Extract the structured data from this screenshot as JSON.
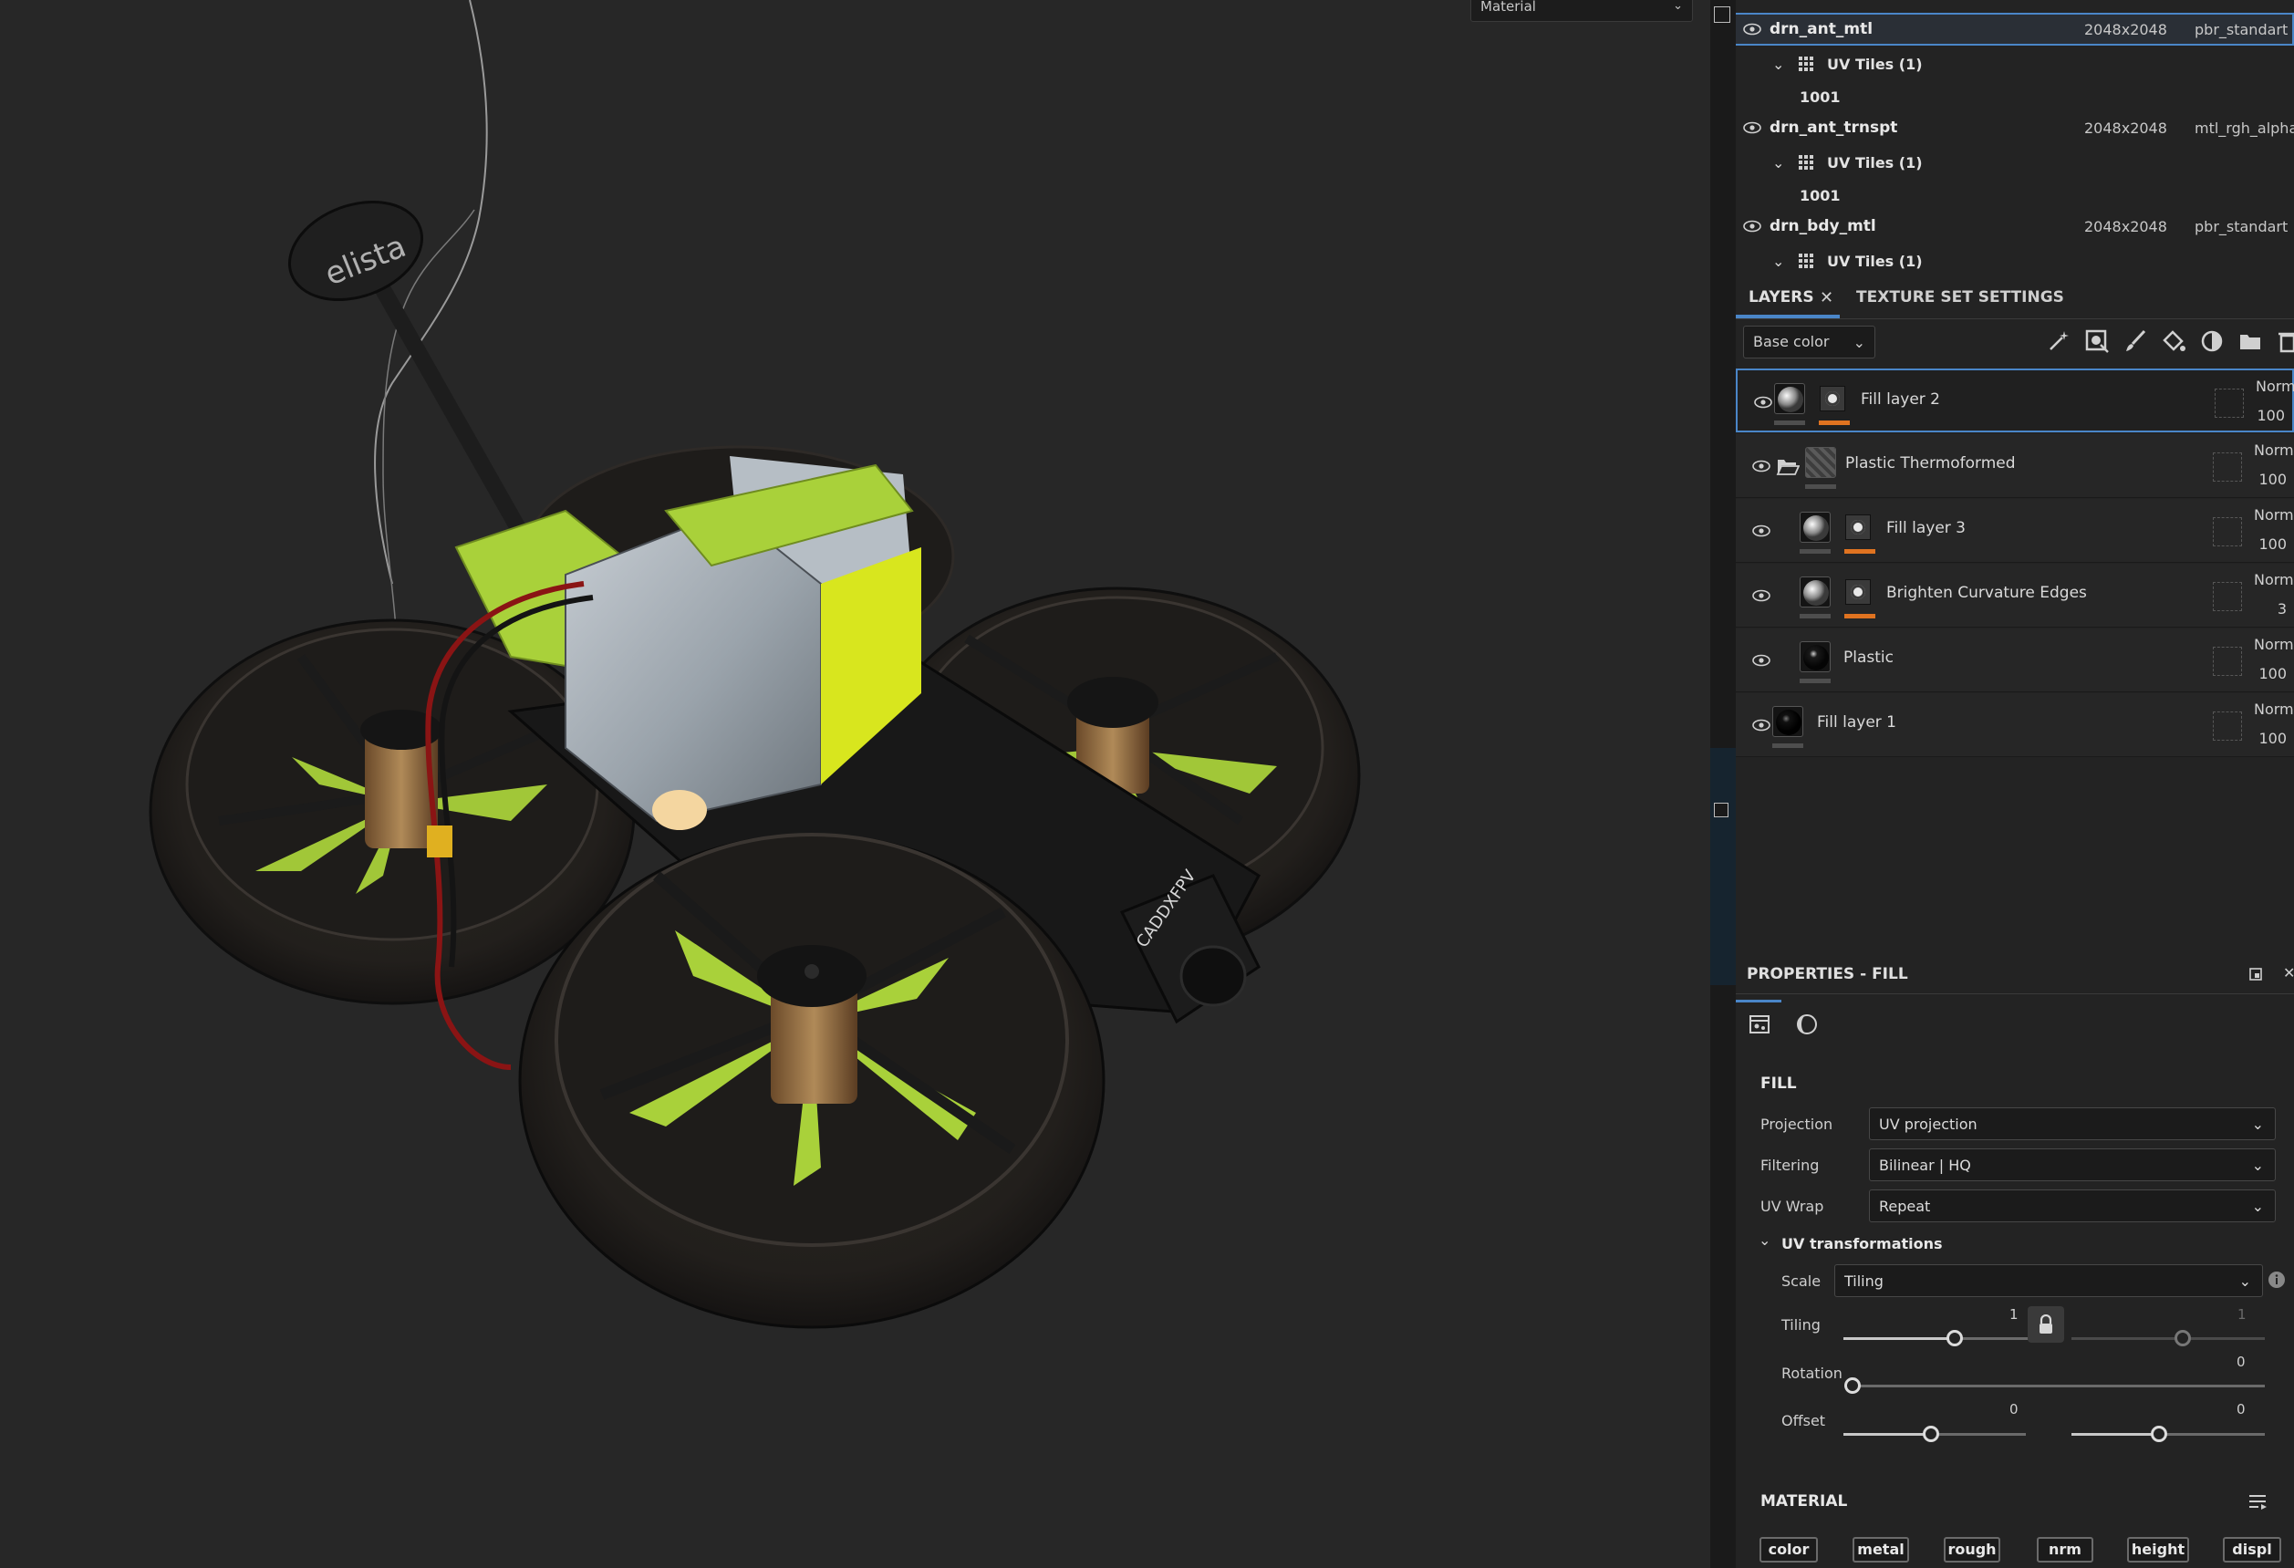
{
  "viewport": {
    "view_mode": "Material",
    "drone_labels": {
      "antenna_brand": "elista",
      "camera_brand": "CADDXFPV"
    }
  },
  "texture_sets": [
    {
      "name": "drn_ant_mtl",
      "resolution": "2048x2048",
      "shader": "pbr_standart",
      "selected": true,
      "uv_tiles": "UV Tiles (1)",
      "tile": "1001"
    },
    {
      "name": "drn_ant_trnspt",
      "resolution": "2048x2048",
      "shader": "mtl_rgh_alpha",
      "selected": false,
      "uv_tiles": "UV Tiles (1)",
      "tile": "1001"
    },
    {
      "name": "drn_bdy_mtl",
      "resolution": "2048x2048",
      "shader": "pbr_standart",
      "selected": false,
      "uv_tiles": "UV Tiles (1)"
    }
  ],
  "tabs": {
    "layers": "LAYERS",
    "texture_set_settings": "TEXTURE SET SETTINGS"
  },
  "layers_toolbar": {
    "channel": "Base color"
  },
  "layers": [
    {
      "name": "Fill layer 2",
      "blend": "Norm",
      "opacity": "100"
    },
    {
      "name": "Plastic Thermoformed",
      "blend": "Norm",
      "opacity": "100"
    },
    {
      "name": "Fill layer 3",
      "blend": "Norm",
      "opacity": "100"
    },
    {
      "name": "Brighten Curvature Edges",
      "blend": "Norm",
      "opacity": "3"
    },
    {
      "name": "Plastic",
      "blend": "Norm",
      "opacity": "100"
    },
    {
      "name": "Fill layer 1",
      "blend": "Norm",
      "opacity": "100"
    }
  ],
  "properties": {
    "title": "PROPERTIES - FILL",
    "fill_section": "FILL",
    "projection_label": "Projection",
    "projection_value": "UV projection",
    "filtering_label": "Filtering",
    "filtering_value": "Bilinear | HQ",
    "uvwrap_label": "UV Wrap",
    "uvwrap_value": "Repeat",
    "uvtrans_label": "UV transformations",
    "scale_label": "Scale",
    "scale_value": "Tiling",
    "tiling_label": "Tiling",
    "tiling_value": "1",
    "tiling_value_2": "1",
    "rotation_label": "Rotation",
    "rotation_value": "0",
    "offset_label": "Offset",
    "offset_x": "0",
    "offset_y": "0",
    "material_section": "MATERIAL",
    "material_channels": [
      "color",
      "metal",
      "rough",
      "nrm",
      "height",
      "displ"
    ]
  },
  "colors": {
    "accent": "#4a86c8",
    "mask_bar": "#e07320",
    "drone_green": "#a9d13a",
    "panel_bg": "#232323",
    "viewport_bg": "#272727"
  }
}
